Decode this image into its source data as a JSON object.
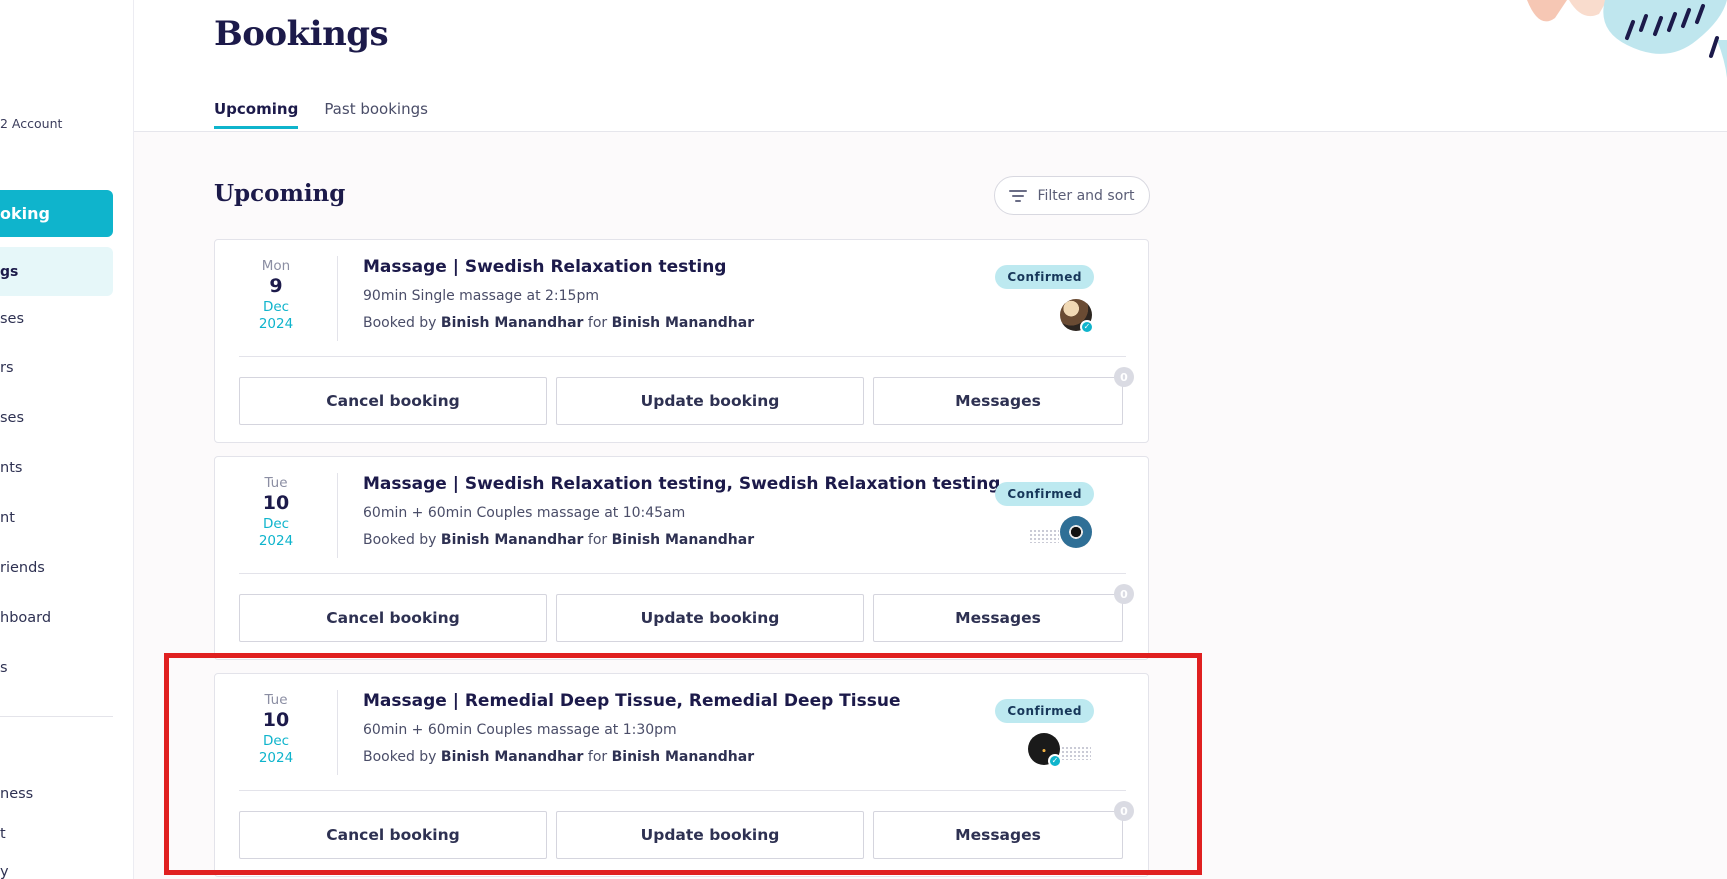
{
  "sidebar": {
    "account_label": "2 Account",
    "primary_button": "oking",
    "active_item": "gs",
    "items": [
      "ses",
      "rs",
      "ses",
      "nts",
      "nt",
      "riends",
      "hboard",
      "s"
    ],
    "bottom_items": [
      "ness",
      "t",
      "y"
    ]
  },
  "header": {
    "title": "Bookings",
    "tabs": [
      {
        "label": "Upcoming",
        "active": true
      },
      {
        "label": "Past bookings",
        "active": false
      }
    ]
  },
  "section": {
    "title": "Upcoming",
    "filter_label": "Filter and sort"
  },
  "bookings": [
    {
      "dow": "Mon",
      "day": "9",
      "month": "Dec",
      "year": "2024",
      "title": "Massage | Swedish Relaxation testing",
      "subtitle": "90min Single massage at 2:15pm",
      "booked_prefix": "Booked by",
      "booked_by": "Binish Manandhar",
      "for_word": "for",
      "booked_for": "Binish Manandhar",
      "status": "Confirmed",
      "cancel_label": "Cancel booking",
      "update_label": "Update booking",
      "messages_label": "Messages",
      "message_count": "0"
    },
    {
      "dow": "Tue",
      "day": "10",
      "month": "Dec",
      "year": "2024",
      "title": "Massage | Swedish Relaxation testing, Swedish Relaxation testing",
      "subtitle": "60min + 60min Couples massage at 10:45am",
      "booked_prefix": "Booked by",
      "booked_by": "Binish Manandhar",
      "for_word": "for",
      "booked_for": "Binish Manandhar",
      "status": "Confirmed",
      "cancel_label": "Cancel booking",
      "update_label": "Update booking",
      "messages_label": "Messages",
      "message_count": "0"
    },
    {
      "dow": "Tue",
      "day": "10",
      "month": "Dec",
      "year": "2024",
      "title": "Massage | Remedial Deep Tissue, Remedial Deep Tissue",
      "subtitle": "60min + 60min Couples massage at 1:30pm",
      "booked_prefix": "Booked by",
      "booked_by": "Binish Manandhar",
      "for_word": "for",
      "booked_for": "Binish Manandhar",
      "status": "Confirmed",
      "cancel_label": "Cancel booking",
      "update_label": "Update booking",
      "messages_label": "Messages",
      "message_count": "0"
    }
  ],
  "icons": {
    "filter": "filter-icon",
    "verified": "verified-check-icon"
  },
  "colors": {
    "accent": "#0fb4cc",
    "navy": "#1c1a4a",
    "badge_bg": "#bde9f0",
    "highlight": "#e02020"
  }
}
